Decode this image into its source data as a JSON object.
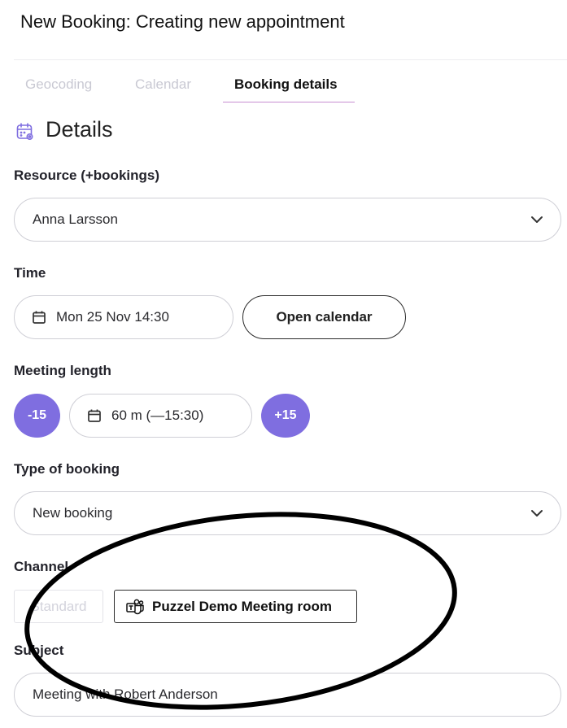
{
  "header": {
    "title": "New Booking: Creating new appointment"
  },
  "tabs": [
    {
      "label": "Geocoding"
    },
    {
      "label": "Calendar"
    },
    {
      "label": "Booking details",
      "active": true
    }
  ],
  "section": {
    "title": "Details",
    "icon": "calendar-settings-icon"
  },
  "resource": {
    "label": "Resource (+bookings)",
    "value": "Anna Larsson"
  },
  "time": {
    "label": "Time",
    "value": "Mon 25 Nov 14:30",
    "open_calendar_label": "Open calendar"
  },
  "meeting_length": {
    "label": "Meeting length",
    "minus_label": "-15",
    "value": "60 m (—15:30)",
    "plus_label": "+15"
  },
  "booking_type": {
    "label": "Type of booking",
    "value": "New booking"
  },
  "channel": {
    "label": "Channel",
    "options": [
      {
        "label": "Standard",
        "selected": false
      },
      {
        "label": "Puzzel Demo Meeting room",
        "selected": true,
        "icon": "teams-icon"
      }
    ]
  },
  "subject": {
    "label": "Subject",
    "value": "Meeting with Robert Anderson"
  },
  "colors": {
    "accent": "#7f6ee0",
    "tab_underline": "#c78fd2",
    "text": "#1c1c24",
    "border": "#cfcfd6"
  }
}
